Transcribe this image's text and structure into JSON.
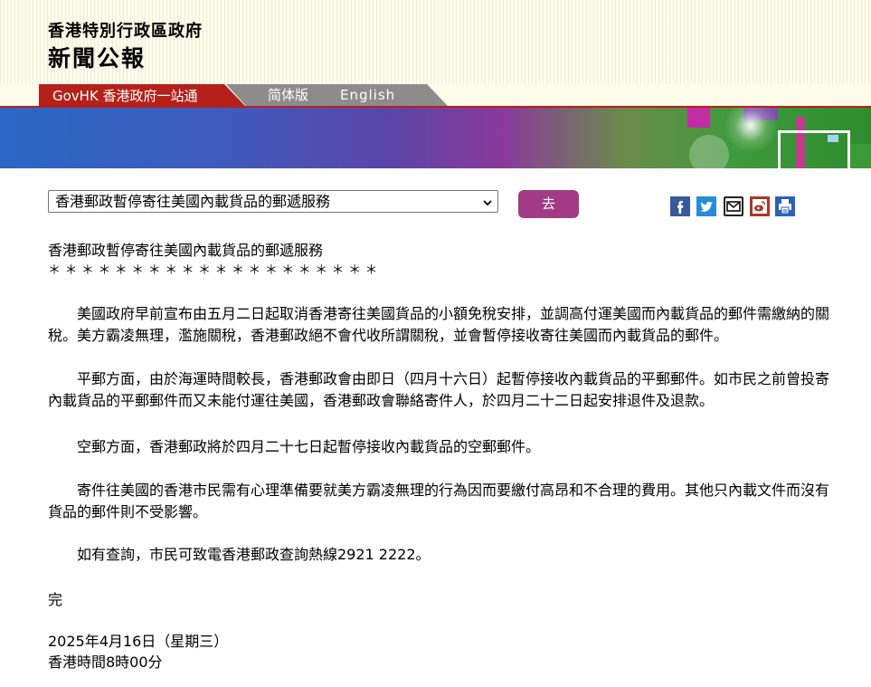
{
  "header": {
    "org": "香港特別行政區政府",
    "title": "新聞公報"
  },
  "nav": {
    "govhk": "GovHK 香港政府一站通",
    "simplified": "简体版",
    "english": "English"
  },
  "selector": {
    "selected": "香港郵政暫停寄往美國內載貨品的郵遞服務",
    "go_label": "去"
  },
  "share_icons": [
    "facebook-icon",
    "twitter-icon",
    "email-icon",
    "weibo-icon",
    "print-icon"
  ],
  "article": {
    "heading": "香港郵政暫停寄往美國內載貨品的郵遞服務",
    "stars": "＊ ＊ ＊ ＊ ＊ ＊ ＊ ＊ ＊ ＊ ＊ ＊ ＊ ＊ ＊ ＊ ＊ ＊ ＊ ＊",
    "paragraphs": [
      "美國政府早前宣布由五月二日起取消香港寄往美國貨品的小額免稅安排，並調高付運美國而內載貨品的郵件需繳納的關稅。美方霸凌無理，濫施關稅，香港郵政絕不會代收所謂關稅，並會暫停接收寄往美國而內載貨品的郵件。",
      "平郵方面，由於海運時間較長，香港郵政會由即日（四月十六日）起暫停接收內載貨品的平郵郵件。如市民之前曾投寄內載貨品的平郵郵件而又未能付運往美國，香港郵政會聯絡寄件人，於四月二十二日起安排退件及退款。",
      "空郵方面，香港郵政將於四月二十七日起暫停接收內載貨品的空郵郵件。",
      "寄件往美國的香港市民需有心理準備要就美方霸凌無理的行為因而要繳付高昂和不合理的費用。其他只內載文件而沒有貨品的郵件則不受影響。",
      "如有查詢，市民可致電香港郵政查詢熱線2921 2222。"
    ],
    "end": "完",
    "date": "2025年4月16日（星期三）",
    "time": "香港時間8時00分"
  }
}
